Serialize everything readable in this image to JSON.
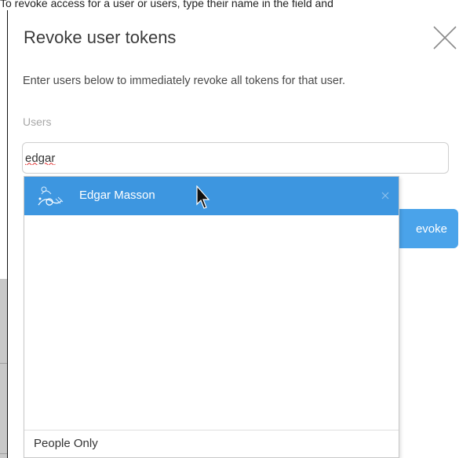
{
  "page": {
    "instruction": "To revoke access for a user or users, type their name in the field and"
  },
  "modal": {
    "title": "Revoke user tokens",
    "description": "Enter users below to immediately revoke all tokens for that user.",
    "users_label": "Users",
    "users_input_value": "edgar",
    "revoke_button_label": "evoke"
  },
  "dropdown": {
    "options": [
      {
        "name": "Edgar Masson",
        "selected": true,
        "avatar_icon": "user-avatar-icon"
      }
    ],
    "footer_label": "People Only"
  },
  "colors": {
    "accent": "#3d96e0",
    "button": "#4aa3ea",
    "overlay_grey": "#c8c8c8"
  }
}
